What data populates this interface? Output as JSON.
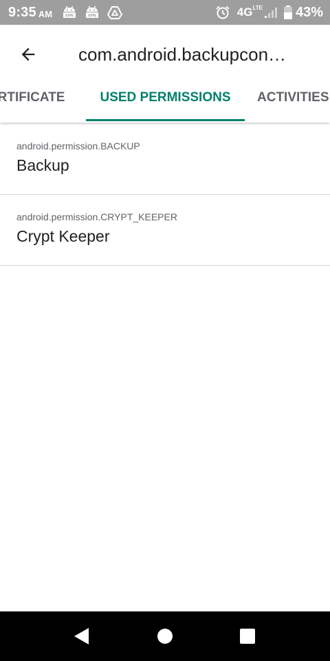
{
  "status_bar": {
    "time": "9:35",
    "ampm": "AM",
    "network": "4G",
    "network_sup": "LTE",
    "battery": "43%",
    "notification_icons": [
      "apk-icon",
      "apk-icon",
      "drive-icon"
    ],
    "apk_label": "APK"
  },
  "app_bar": {
    "title": "com.android.backupcon…"
  },
  "tabs": [
    {
      "label": "ERTIFICATE",
      "selected": false
    },
    {
      "label": "USED PERMISSIONS",
      "selected": true
    },
    {
      "label": "ACTIVITIES",
      "selected": false
    }
  ],
  "permissions": [
    {
      "name": "android.permission.BACKUP",
      "label": "Backup"
    },
    {
      "name": "android.permission.CRYPT_KEEPER",
      "label": "Crypt Keeper"
    }
  ],
  "colors": {
    "status_bar": "#9e9e9e",
    "accent": "#00806b",
    "tab_text": "#5f6368",
    "primary_text": "#212121"
  },
  "nav_bar": {
    "icons": [
      "back-triangle-icon",
      "home-circle-icon",
      "recents-square-icon"
    ]
  }
}
